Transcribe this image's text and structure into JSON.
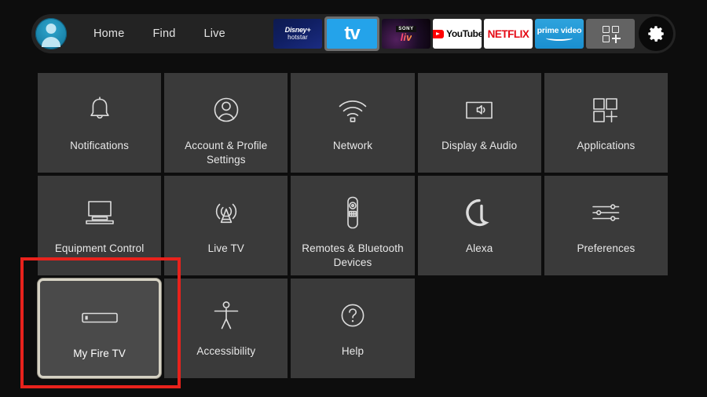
{
  "nav": {
    "avatar": "profile-avatar",
    "links": [
      {
        "label": "Home"
      },
      {
        "label": "Find"
      },
      {
        "label": "Live"
      }
    ],
    "apps": [
      {
        "name": "disney-hotstar",
        "line1": "Disney+",
        "line2": "hotstar",
        "focused": false
      },
      {
        "name": "apple-tv",
        "label": "tv",
        "focused": true
      },
      {
        "name": "sony-liv",
        "line1": "SONY",
        "line2": "liv",
        "focused": false
      },
      {
        "name": "youtube",
        "label": "YouTube",
        "focused": false
      },
      {
        "name": "netflix",
        "label": "NETFLIX",
        "focused": false
      },
      {
        "name": "prime-video",
        "label": "prime video",
        "focused": false
      },
      {
        "name": "more-apps",
        "label": "",
        "focused": false
      }
    ],
    "settings_button": "gear-icon"
  },
  "grid": {
    "tiles": [
      {
        "label": "Notifications",
        "icon": "bell-icon",
        "focused": false
      },
      {
        "label": "Account & Profile Settings",
        "icon": "person-circle-icon",
        "focused": false
      },
      {
        "label": "Network",
        "icon": "wifi-icon",
        "focused": false
      },
      {
        "label": "Display & Audio",
        "icon": "display-audio-icon",
        "focused": false
      },
      {
        "label": "Applications",
        "icon": "app-grid-plus-icon",
        "focused": false
      },
      {
        "label": "Equipment Control",
        "icon": "tv-soundbar-icon",
        "focused": false
      },
      {
        "label": "Live TV",
        "icon": "broadcast-tower-icon",
        "focused": false
      },
      {
        "label": "Remotes & Bluetooth Devices",
        "icon": "remote-icon",
        "focused": false
      },
      {
        "label": "Alexa",
        "icon": "alexa-ring-icon",
        "focused": false
      },
      {
        "label": "Preferences",
        "icon": "sliders-icon",
        "focused": false
      },
      {
        "label": "My Fire TV",
        "icon": "fire-tv-stick-icon",
        "focused": true
      },
      {
        "label": "Accessibility",
        "icon": "accessibility-icon",
        "focused": false
      },
      {
        "label": "Help",
        "icon": "question-circle-icon",
        "focused": false
      }
    ]
  },
  "annotation": {
    "name": "red-highlight-box",
    "color": "#e8221c",
    "target": "My Fire TV"
  },
  "colors": {
    "background": "#0d0d0d",
    "topbar": "#232323",
    "tile": "#3a3a3a",
    "tile_focused": "#4a4a4a",
    "focus_border": "#d6d2c4",
    "text": "#e8e8e8",
    "accent_red": "#e8221c",
    "avatar": "#1b86ad"
  }
}
